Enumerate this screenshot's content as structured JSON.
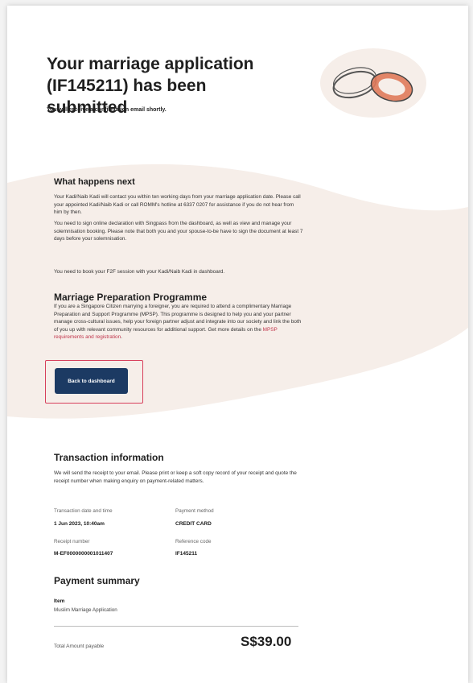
{
  "header": {
    "title": "Your marriage application (IF145211) has been submitted",
    "subtitle": "You will receive a confirmation email shortly."
  },
  "next": {
    "heading": "What happens next",
    "para1": "Your Kadi/Naib Kadi will contact you within ten working days from your marriage application date. Please call your appointed Kadi/Naib Kadi or call ROMM's hotline at 6337 0207 for assistance if you do not hear from him by then.",
    "para2": "You need to sign online declaration with Singpass from the dashboard, as well as view and manage your solemnisation booking. Please note that both you and your spouse-to-be have to sign the document at least 7 days before your solemnisation.",
    "para3": "You need to book your F2F session with your Kadi/Naib Kadi in dashboard."
  },
  "mpsp": {
    "heading": "Marriage Preparation Programme",
    "text": "If you are a Singapore Citizen marrying a foreigner, you are required to attend a complimentary Marriage Preparation and Support Programme (MPSP). This programme is designed to help you and your partner manage cross-cultural issues, help your foreign partner adjust and integrate into our society and link the both of you up with relevant community resources for additional support. Get more details on the ",
    "link": "MPSP requirements and registration",
    "link_suffix": "."
  },
  "button": {
    "label": "Back to dashboard"
  },
  "transaction": {
    "heading": "Transaction information",
    "intro": "We will send the receipt to your email. Please print or keep a soft copy record of your receipt and quote the receipt number when making enquiry on payment-related matters.",
    "date_label": "Transaction date and time",
    "date_value": "1 Jun 2023, 10:40am",
    "method_label": "Payment method",
    "method_value": "CREDIT CARD",
    "receipt_label": "Receipt number",
    "receipt_value": "M-EF0000000001011407",
    "ref_label": "Reference code",
    "ref_value": "IF145211"
  },
  "payment": {
    "heading": "Payment summary",
    "item_label": "Item",
    "item_value": "Muslim Marriage Application",
    "total_label": "Total Amount payable",
    "total_value": "S$39.00"
  },
  "colors": {
    "accent": "#c0344b",
    "button_bg": "#1c3a63",
    "highlight_border": "#d73f5b",
    "wave": "#f6eee9",
    "ring_orange": "#e07a5b"
  },
  "icons": {
    "illustration": "wedding-rings-icon"
  }
}
